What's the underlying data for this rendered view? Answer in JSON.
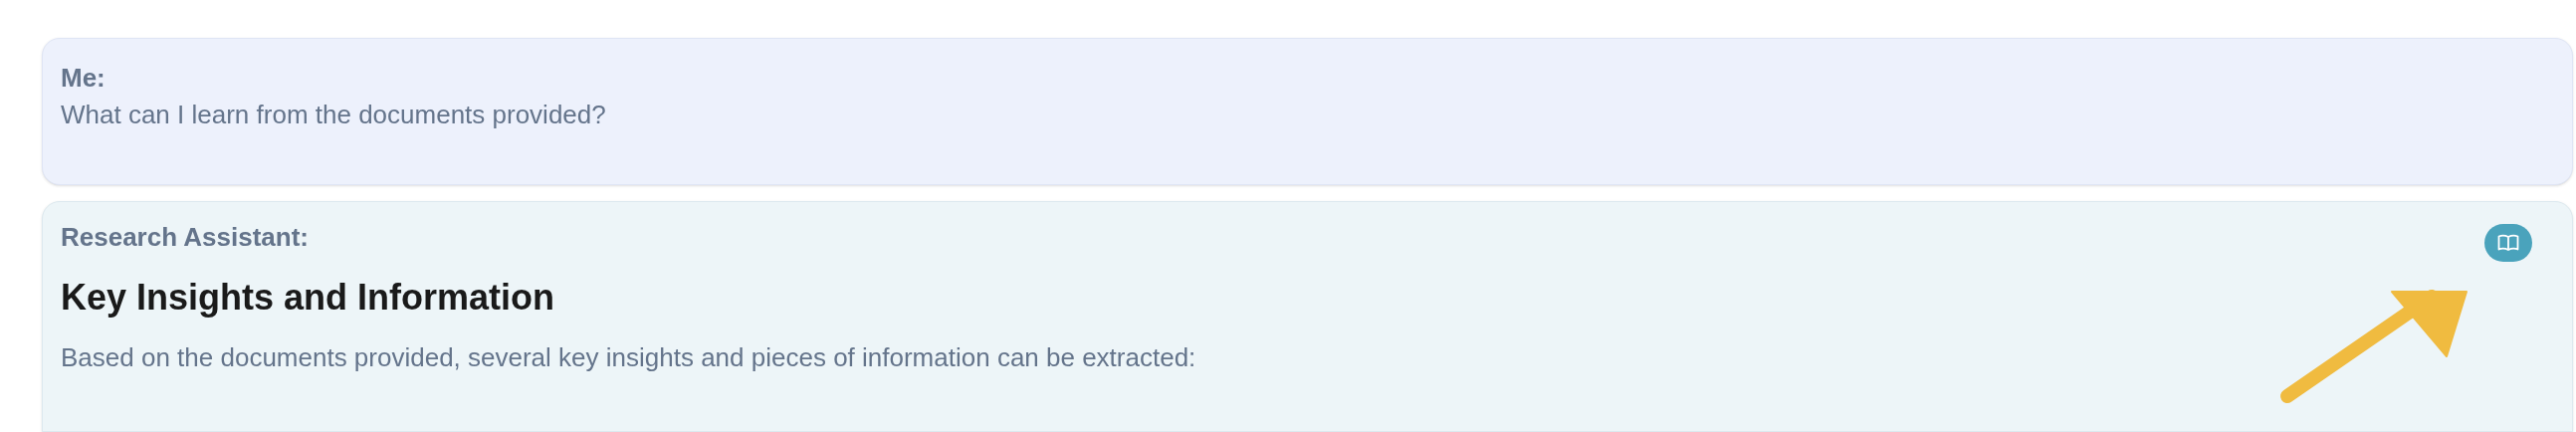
{
  "messages": [
    {
      "kind": "user",
      "sender": "Me:",
      "text": "What can I learn from the documents provided?"
    },
    {
      "kind": "assistant",
      "sender": "Research Assistant:",
      "heading": "Key Insights and Information",
      "text": "Based on the documents provided, several key insights and pieces of information can be extracted:"
    }
  ]
}
